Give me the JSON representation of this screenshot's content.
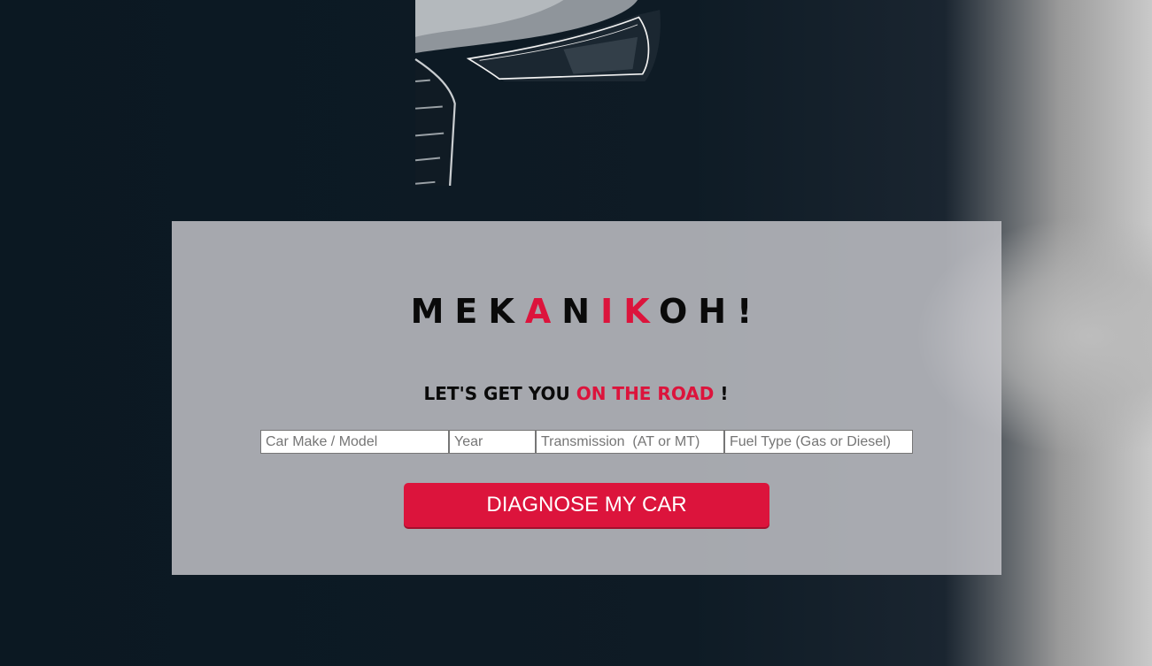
{
  "brand": {
    "part1": "MEK",
    "part2": "A",
    "part3": "N",
    "part4": "IK",
    "part5": "OH!"
  },
  "tagline": {
    "lead": "LET'S GET YOU ",
    "accent": "ON THE ROAD",
    "tail": " !"
  },
  "form": {
    "make_placeholder": "Car Make / Model",
    "year_placeholder": "Year",
    "transmission_placeholder": "Transmission  (AT or MT)",
    "fuel_placeholder": "Fuel Type (Gas or Diesel)",
    "submit_label": "DIAGNOSE MY CAR"
  },
  "theme": {
    "accent_color": "#dc143c",
    "text_color": "#0a0a0a"
  },
  "background": {
    "icon": "car-headlight-photo"
  }
}
